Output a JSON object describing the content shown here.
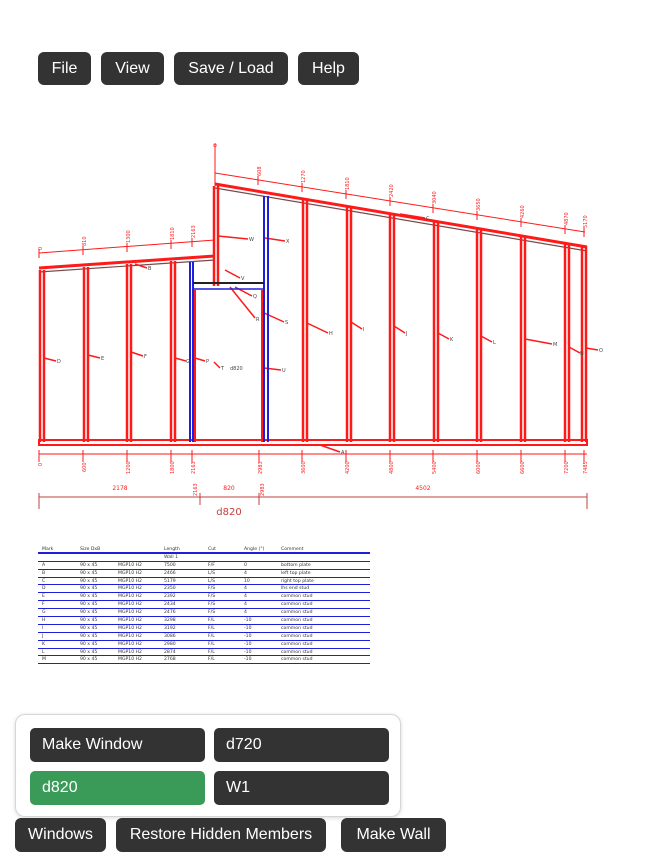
{
  "menu": {
    "file": "File",
    "view": "View",
    "save_load": "Save / Load",
    "help": "Help"
  },
  "colors": {
    "button_bg": "#333333",
    "active_bg": "#3a9a57",
    "frame_red": "#ff1a1a",
    "frame_blue": "#1f1fd8"
  },
  "drawing": {
    "top_dims": [
      "0",
      "810",
      "1300",
      "1810",
      "2163",
      "0",
      "608",
      "1270",
      "1810",
      "2420",
      "3040",
      "3650",
      "4260",
      "4870",
      "5170"
    ],
    "member_labels": [
      "B",
      "D",
      "E",
      "F",
      "G",
      "H",
      "I",
      "J",
      "K",
      "L",
      "M",
      "N",
      "O",
      "P",
      "Q",
      "R",
      "S",
      "T",
      "U",
      "V",
      "W",
      "X",
      "A",
      "C"
    ],
    "bottom_dims": [
      "0",
      "600",
      "1200",
      "1800",
      "2163",
      "2983",
      "3600",
      "4200",
      "4800",
      "5400",
      "6000",
      "6600",
      "7200",
      "7485"
    ],
    "segments": [
      "2178",
      "820",
      "4502"
    ],
    "split_dims": [
      "2163",
      "2983"
    ],
    "opening_label": "d820",
    "opening_tag": "T",
    "total_label": "d820"
  },
  "table": {
    "headers": [
      "Mark",
      "Size DxB",
      "",
      "Length",
      "Cut",
      "Angle (°)",
      "Comment"
    ],
    "wall_label": "Wall 1",
    "rows": [
      [
        "A",
        "90 x 45",
        "MGP10 H2",
        "7500",
        "F/F",
        "0",
        "bottom plate"
      ],
      [
        "B",
        "90 x 45",
        "MGP10 H2",
        "2466",
        "L/S",
        "4",
        "left top plate"
      ],
      [
        "C",
        "90 x 45",
        "MGP10 H2",
        "5179",
        "L/S",
        "10",
        "right top plate"
      ],
      [
        "D",
        "90 x 45",
        "MGP10 H2",
        "2350",
        "F/S",
        "4",
        "lhs end stud"
      ],
      [
        "E",
        "90 x 45",
        "MGP10 H2",
        "2392",
        "F/S",
        "4",
        "common stud"
      ],
      [
        "F",
        "90 x 45",
        "MGP10 H2",
        "2434",
        "F/S",
        "4",
        "common stud"
      ],
      [
        "G",
        "90 x 45",
        "MGP10 H2",
        "2476",
        "F/S",
        "4",
        "common stud"
      ],
      [
        "H",
        "90 x 45",
        "MGP10 H2",
        "3298",
        "F/L",
        "-10",
        "common stud"
      ],
      [
        "I",
        "90 x 45",
        "MGP10 H2",
        "3192",
        "F/L",
        "-10",
        "common stud"
      ],
      [
        "J",
        "90 x 45",
        "MGP10 H2",
        "3086",
        "F/L",
        "-10",
        "common stud"
      ],
      [
        "K",
        "90 x 45",
        "MGP10 H2",
        "2980",
        "F/L",
        "-10",
        "common stud"
      ],
      [
        "L",
        "90 x 45",
        "MGP10 H2",
        "2874",
        "F/L",
        "-10",
        "common stud"
      ],
      [
        "M",
        "90 x 45",
        "MGP10 H2",
        "2768",
        "F/L",
        "-10",
        "common stud"
      ]
    ]
  },
  "panel": {
    "make_window": "Make Window",
    "d720": "d720",
    "d820": "d820",
    "w1": "W1"
  },
  "bottom_bar": {
    "windows": "Windows",
    "restore": "Restore Hidden Members",
    "make_wall": "Make Wall"
  }
}
